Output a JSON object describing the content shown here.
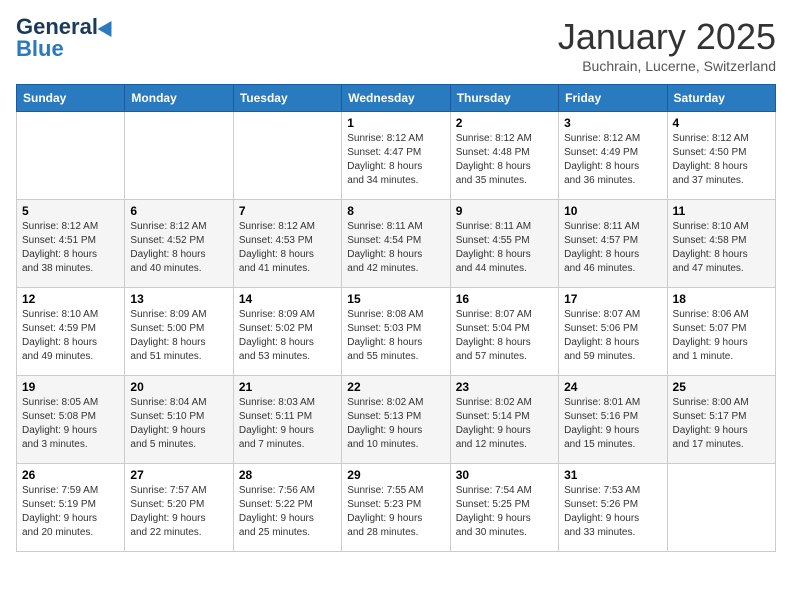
{
  "header": {
    "logo": {
      "general": "General",
      "blue": "Blue"
    },
    "title": "January 2025",
    "location": "Buchrain, Lucerne, Switzerland"
  },
  "calendar": {
    "weekdays": [
      "Sunday",
      "Monday",
      "Tuesday",
      "Wednesday",
      "Thursday",
      "Friday",
      "Saturday"
    ],
    "weeks": [
      [
        {
          "day": "",
          "info": ""
        },
        {
          "day": "",
          "info": ""
        },
        {
          "day": "",
          "info": ""
        },
        {
          "day": "1",
          "info": "Sunrise: 8:12 AM\nSunset: 4:47 PM\nDaylight: 8 hours\nand 34 minutes."
        },
        {
          "day": "2",
          "info": "Sunrise: 8:12 AM\nSunset: 4:48 PM\nDaylight: 8 hours\nand 35 minutes."
        },
        {
          "day": "3",
          "info": "Sunrise: 8:12 AM\nSunset: 4:49 PM\nDaylight: 8 hours\nand 36 minutes."
        },
        {
          "day": "4",
          "info": "Sunrise: 8:12 AM\nSunset: 4:50 PM\nDaylight: 8 hours\nand 37 minutes."
        }
      ],
      [
        {
          "day": "5",
          "info": "Sunrise: 8:12 AM\nSunset: 4:51 PM\nDaylight: 8 hours\nand 38 minutes."
        },
        {
          "day": "6",
          "info": "Sunrise: 8:12 AM\nSunset: 4:52 PM\nDaylight: 8 hours\nand 40 minutes."
        },
        {
          "day": "7",
          "info": "Sunrise: 8:12 AM\nSunset: 4:53 PM\nDaylight: 8 hours\nand 41 minutes."
        },
        {
          "day": "8",
          "info": "Sunrise: 8:11 AM\nSunset: 4:54 PM\nDaylight: 8 hours\nand 42 minutes."
        },
        {
          "day": "9",
          "info": "Sunrise: 8:11 AM\nSunset: 4:55 PM\nDaylight: 8 hours\nand 44 minutes."
        },
        {
          "day": "10",
          "info": "Sunrise: 8:11 AM\nSunset: 4:57 PM\nDaylight: 8 hours\nand 46 minutes."
        },
        {
          "day": "11",
          "info": "Sunrise: 8:10 AM\nSunset: 4:58 PM\nDaylight: 8 hours\nand 47 minutes."
        }
      ],
      [
        {
          "day": "12",
          "info": "Sunrise: 8:10 AM\nSunset: 4:59 PM\nDaylight: 8 hours\nand 49 minutes."
        },
        {
          "day": "13",
          "info": "Sunrise: 8:09 AM\nSunset: 5:00 PM\nDaylight: 8 hours\nand 51 minutes."
        },
        {
          "day": "14",
          "info": "Sunrise: 8:09 AM\nSunset: 5:02 PM\nDaylight: 8 hours\nand 53 minutes."
        },
        {
          "day": "15",
          "info": "Sunrise: 8:08 AM\nSunset: 5:03 PM\nDaylight: 8 hours\nand 55 minutes."
        },
        {
          "day": "16",
          "info": "Sunrise: 8:07 AM\nSunset: 5:04 PM\nDaylight: 8 hours\nand 57 minutes."
        },
        {
          "day": "17",
          "info": "Sunrise: 8:07 AM\nSunset: 5:06 PM\nDaylight: 8 hours\nand 59 minutes."
        },
        {
          "day": "18",
          "info": "Sunrise: 8:06 AM\nSunset: 5:07 PM\nDaylight: 9 hours\nand 1 minute."
        }
      ],
      [
        {
          "day": "19",
          "info": "Sunrise: 8:05 AM\nSunset: 5:08 PM\nDaylight: 9 hours\nand 3 minutes."
        },
        {
          "day": "20",
          "info": "Sunrise: 8:04 AM\nSunset: 5:10 PM\nDaylight: 9 hours\nand 5 minutes."
        },
        {
          "day": "21",
          "info": "Sunrise: 8:03 AM\nSunset: 5:11 PM\nDaylight: 9 hours\nand 7 minutes."
        },
        {
          "day": "22",
          "info": "Sunrise: 8:02 AM\nSunset: 5:13 PM\nDaylight: 9 hours\nand 10 minutes."
        },
        {
          "day": "23",
          "info": "Sunrise: 8:02 AM\nSunset: 5:14 PM\nDaylight: 9 hours\nand 12 minutes."
        },
        {
          "day": "24",
          "info": "Sunrise: 8:01 AM\nSunset: 5:16 PM\nDaylight: 9 hours\nand 15 minutes."
        },
        {
          "day": "25",
          "info": "Sunrise: 8:00 AM\nSunset: 5:17 PM\nDaylight: 9 hours\nand 17 minutes."
        }
      ],
      [
        {
          "day": "26",
          "info": "Sunrise: 7:59 AM\nSunset: 5:19 PM\nDaylight: 9 hours\nand 20 minutes."
        },
        {
          "day": "27",
          "info": "Sunrise: 7:57 AM\nSunset: 5:20 PM\nDaylight: 9 hours\nand 22 minutes."
        },
        {
          "day": "28",
          "info": "Sunrise: 7:56 AM\nSunset: 5:22 PM\nDaylight: 9 hours\nand 25 minutes."
        },
        {
          "day": "29",
          "info": "Sunrise: 7:55 AM\nSunset: 5:23 PM\nDaylight: 9 hours\nand 28 minutes."
        },
        {
          "day": "30",
          "info": "Sunrise: 7:54 AM\nSunset: 5:25 PM\nDaylight: 9 hours\nand 30 minutes."
        },
        {
          "day": "31",
          "info": "Sunrise: 7:53 AM\nSunset: 5:26 PM\nDaylight: 9 hours\nand 33 minutes."
        },
        {
          "day": "",
          "info": ""
        }
      ]
    ]
  }
}
